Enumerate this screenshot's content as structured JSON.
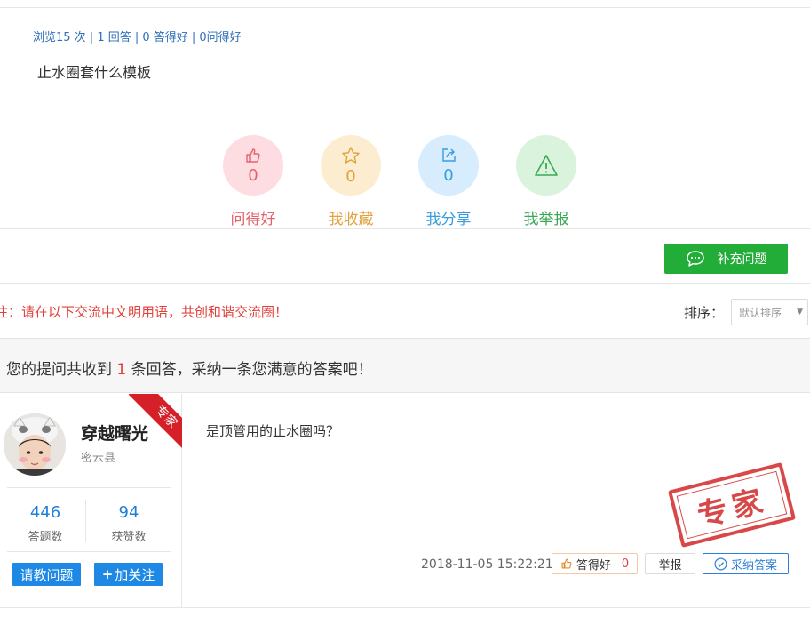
{
  "question": {
    "stats": "浏览15 次 | 1 回答 | 0 答得好 | 0问得好",
    "title": "止水圈套什么模板"
  },
  "actions": [
    {
      "label": "问得好",
      "count": "0",
      "icon": "thumbs-up-icon",
      "color": "#e5626d",
      "bg": "#fddde1"
    },
    {
      "label": "我收藏",
      "count": "0",
      "icon": "star-icon",
      "color": "#e1a13a",
      "bg": "#fdedd0"
    },
    {
      "label": "我分享",
      "count": "0",
      "icon": "share-icon",
      "color": "#3a9de1",
      "bg": "#d7ecfd"
    },
    {
      "label": "我举报",
      "count": "",
      "icon": "warning-icon",
      "color": "#3aa955",
      "bg": "#d9f3dd"
    }
  ],
  "toolbar": {
    "supplement_label": "补充问题"
  },
  "notice": "注：请在以下交流中文明用语，共创和谐交流圈！",
  "sort": {
    "label": "排序：",
    "selected": "默认排序"
  },
  "answers_banner": {
    "prefix": "您的提问共收到 ",
    "count": "1",
    "suffix": " 条回答，采纳一条您满意的答案吧！"
  },
  "answerer": {
    "name": "穿越曙光",
    "location": "密云县",
    "badge": "专家",
    "answers_count": "446",
    "answers_label": "答题数",
    "likes_count": "94",
    "likes_label": "获赞数",
    "ask_button": "请教问题",
    "follow_button": "加关注"
  },
  "answer": {
    "text": "是顶管用的止水圈吗？",
    "stamp": "专家",
    "time": "2018-11-05 15:22:21",
    "good_label": "答得好",
    "good_count": "0",
    "report_label": "举报",
    "accept_label": "采纳答案"
  },
  "colors": {
    "accent_green": "#22ac38",
    "accent_blue": "#1e88e5",
    "alert_red": "#e2403b"
  }
}
